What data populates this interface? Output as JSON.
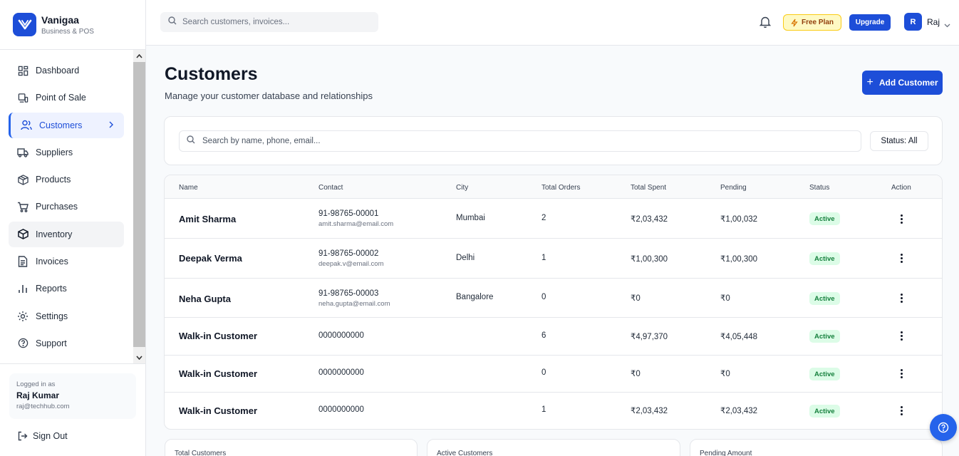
{
  "brand": {
    "name": "Vanigaa",
    "subtitle": "Business & POS"
  },
  "sidebar": {
    "items": [
      {
        "label": "Dashboard",
        "icon": "dashboard-grid-icon"
      },
      {
        "label": "Point of Sale",
        "icon": "point-of-sale-icon"
      },
      {
        "label": "Customers",
        "icon": "users-icon",
        "active": true
      },
      {
        "label": "Suppliers",
        "icon": "truck-icon"
      },
      {
        "label": "Products",
        "icon": "package-icon"
      },
      {
        "label": "Purchases",
        "icon": "shopping-cart-icon"
      },
      {
        "label": "Inventory",
        "icon": "box-icon",
        "hover": true
      },
      {
        "label": "Invoices",
        "icon": "file-text-icon"
      },
      {
        "label": "Reports",
        "icon": "bar-chart-icon"
      },
      {
        "label": "Settings",
        "icon": "gear-icon"
      },
      {
        "label": "Support",
        "icon": "help-circle-icon"
      }
    ],
    "user": {
      "logged_in_label": "Logged in as",
      "name": "Raj Kumar",
      "email": "raj@techhub.com"
    },
    "signout_label": "Sign Out"
  },
  "header": {
    "search_placeholder": "Search customers, invoices...",
    "plan_label": "Free Plan",
    "upgrade_label": "Upgrade",
    "avatar_initial": "R",
    "user_name": "Raj"
  },
  "page": {
    "title": "Customers",
    "subtitle": "Manage your customer database and relationships",
    "add_button": "Add Customer"
  },
  "filters": {
    "search_placeholder": "Search by name, phone, email...",
    "status_label": "Status: All"
  },
  "table": {
    "columns": [
      "Name",
      "Contact",
      "City",
      "Total Orders",
      "Total Spent",
      "Pending",
      "Status",
      "Action"
    ],
    "rows": [
      {
        "name": "Amit Sharma",
        "phone": "91-98765-00001",
        "email": "amit.sharma@email.com",
        "city": "Mumbai",
        "orders": "2",
        "spent": "₹2,03,432",
        "pending": "₹1,00,032",
        "status": "Active"
      },
      {
        "name": "Deepak Verma",
        "phone": "91-98765-00002",
        "email": "deepak.v@email.com",
        "city": "Delhi",
        "orders": "1",
        "spent": "₹1,00,300",
        "pending": "₹1,00,300",
        "status": "Active"
      },
      {
        "name": "Neha Gupta",
        "phone": "91-98765-00003",
        "email": "neha.gupta@email.com",
        "city": "Bangalore",
        "orders": "0",
        "spent": "₹0",
        "pending": "₹0",
        "status": "Active"
      },
      {
        "name": "Walk-in Customer",
        "phone": "0000000000",
        "email": "",
        "city": "",
        "orders": "6",
        "spent": "₹4,97,370",
        "pending": "₹4,05,448",
        "status": "Active"
      },
      {
        "name": "Walk-in Customer",
        "phone": "0000000000",
        "email": "",
        "city": "",
        "orders": "0",
        "spent": "₹0",
        "pending": "₹0",
        "status": "Active"
      },
      {
        "name": "Walk-in Customer",
        "phone": "0000000000",
        "email": "",
        "city": "",
        "orders": "1",
        "spent": "₹2,03,432",
        "pending": "₹2,03,432",
        "status": "Active"
      }
    ]
  },
  "stats": [
    {
      "label": "Total Customers"
    },
    {
      "label": "Active Customers"
    },
    {
      "label": "Pending Amount"
    }
  ],
  "colors": {
    "accent": "#1d4ed8",
    "active_badge_bg": "#dcfce7",
    "active_badge_text": "#15803d",
    "plan_bg": "#fef9c3"
  }
}
